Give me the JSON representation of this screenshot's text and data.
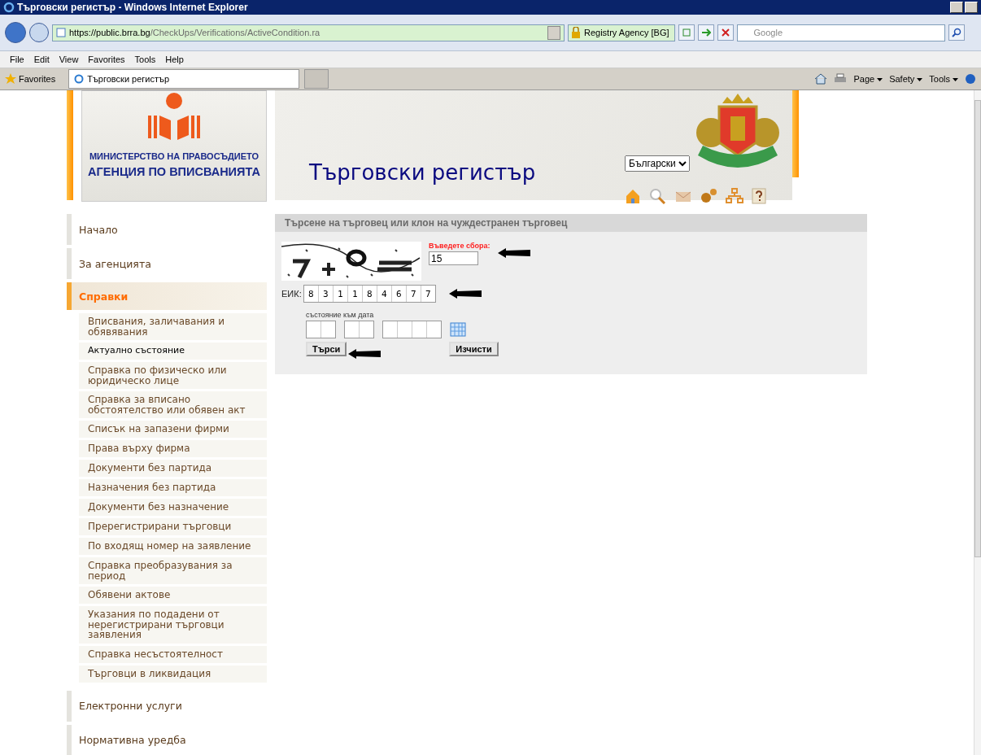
{
  "window": {
    "title": "Търговски регистър - Windows Internet Explorer"
  },
  "address_bar": {
    "url_host": "https://public.brra.bg",
    "url_path": "/CheckUps/Verifications/ActiveCondition.ra",
    "security_label": "Registry Agency [BG]",
    "search_placeholder": "Google"
  },
  "menu_bar": [
    "File",
    "Edit",
    "View",
    "Favorites",
    "Tools",
    "Help"
  ],
  "favorites_bar": {
    "favorites": "Favorites",
    "tab_title": "Търговски регистър",
    "commands": [
      "Page",
      "Safety",
      "Tools"
    ]
  },
  "header": {
    "logo_lines": [
      "МИНИСТЕРСТВО НА ПРАВОСЪДИЕТО",
      "АГЕНЦИЯ ПО ВПИСВАНИЯТА"
    ],
    "site_title": "Търговски регистър",
    "language": "Български"
  },
  "nav": [
    {
      "label": "Начало",
      "selected": false
    },
    {
      "label": "За агенцията",
      "selected": false
    },
    {
      "label": "Справки",
      "selected": true,
      "children": [
        {
          "label": "Вписвания, заличавания и обявявания",
          "selected": false
        },
        {
          "label": "Актуално състояние",
          "selected": true
        },
        {
          "label": "Справка по физическо или юридическо лице",
          "selected": false
        },
        {
          "label": "Справка за вписано обстоятелство или обявен акт",
          "selected": false
        },
        {
          "label": "Списък на запазени фирми",
          "selected": false
        },
        {
          "label": "Права върху фирма",
          "selected": false
        },
        {
          "label": "Документи без партида",
          "selected": false
        },
        {
          "label": "Назначения без партида",
          "selected": false
        },
        {
          "label": "Документи без назначение",
          "selected": false
        },
        {
          "label": "Пререгистрирани търговци",
          "selected": false
        },
        {
          "label": "По входящ номер на заявление",
          "selected": false
        },
        {
          "label": "Справка преобразувания за период",
          "selected": false
        },
        {
          "label": "Обявени актове",
          "selected": false
        },
        {
          "label": "Указания по подадени от нерегистрирани търговци заявления",
          "selected": false
        },
        {
          "label": "Справка несъстоятелност",
          "selected": false
        },
        {
          "label": "Търговци в ликвидация",
          "selected": false
        }
      ]
    },
    {
      "label": "Електронни услуги",
      "selected": false
    },
    {
      "label": "Нормативна уредба",
      "selected": false
    }
  ],
  "search_panel": {
    "title": "Търсене на търговец или клон на чуждестранен търговец",
    "captcha_label": "Въведете сбора:",
    "captcha_value": "15",
    "eik_label": "ЕИК:",
    "eik_digits": [
      "8",
      "3",
      "1",
      "1",
      "8",
      "4",
      "6",
      "7",
      "7"
    ],
    "date_label": "състояние към дата",
    "buttons": [
      "Търси",
      "Изчисти"
    ]
  }
}
